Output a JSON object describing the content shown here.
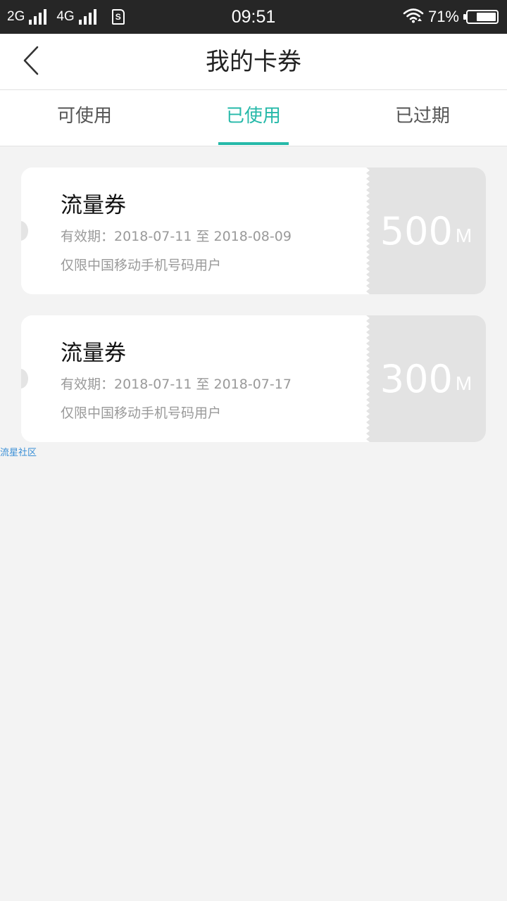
{
  "status_bar": {
    "network_1": "2G",
    "network_2": "4G",
    "sim_symbol": "S",
    "time": "09:51",
    "battery_percent": "71%",
    "battery_level": 0.71,
    "icons": [
      "signal-icon",
      "sim-icon",
      "wifi-icon",
      "battery-icon"
    ]
  },
  "header": {
    "title": "我的卡券",
    "back_icon": "chevron-left-icon"
  },
  "tabs": [
    {
      "label": "可使用",
      "active": false
    },
    {
      "label": "已使用",
      "active": true
    },
    {
      "label": "已过期",
      "active": false
    }
  ],
  "coupons": [
    {
      "title": "流量券",
      "validity": "有效期：2018-07-11 至 2018-08-09",
      "restriction": "仅限中国移动手机号码用户",
      "amount": "500",
      "unit": "M"
    },
    {
      "title": "流量券",
      "validity": "有效期：2018-07-11 至 2018-07-17",
      "restriction": "仅限中国移动手机号码用户",
      "amount": "300",
      "unit": "M"
    }
  ],
  "watermark": "流星社区",
  "colors": {
    "accent": "#26b9a9",
    "status_bar_bg": "#262626",
    "page_bg": "#f3f3f3",
    "coupon_used_bg": "#e3e3e3",
    "muted_text": "#9a9a9a",
    "watermark": "#3a8fd6"
  }
}
